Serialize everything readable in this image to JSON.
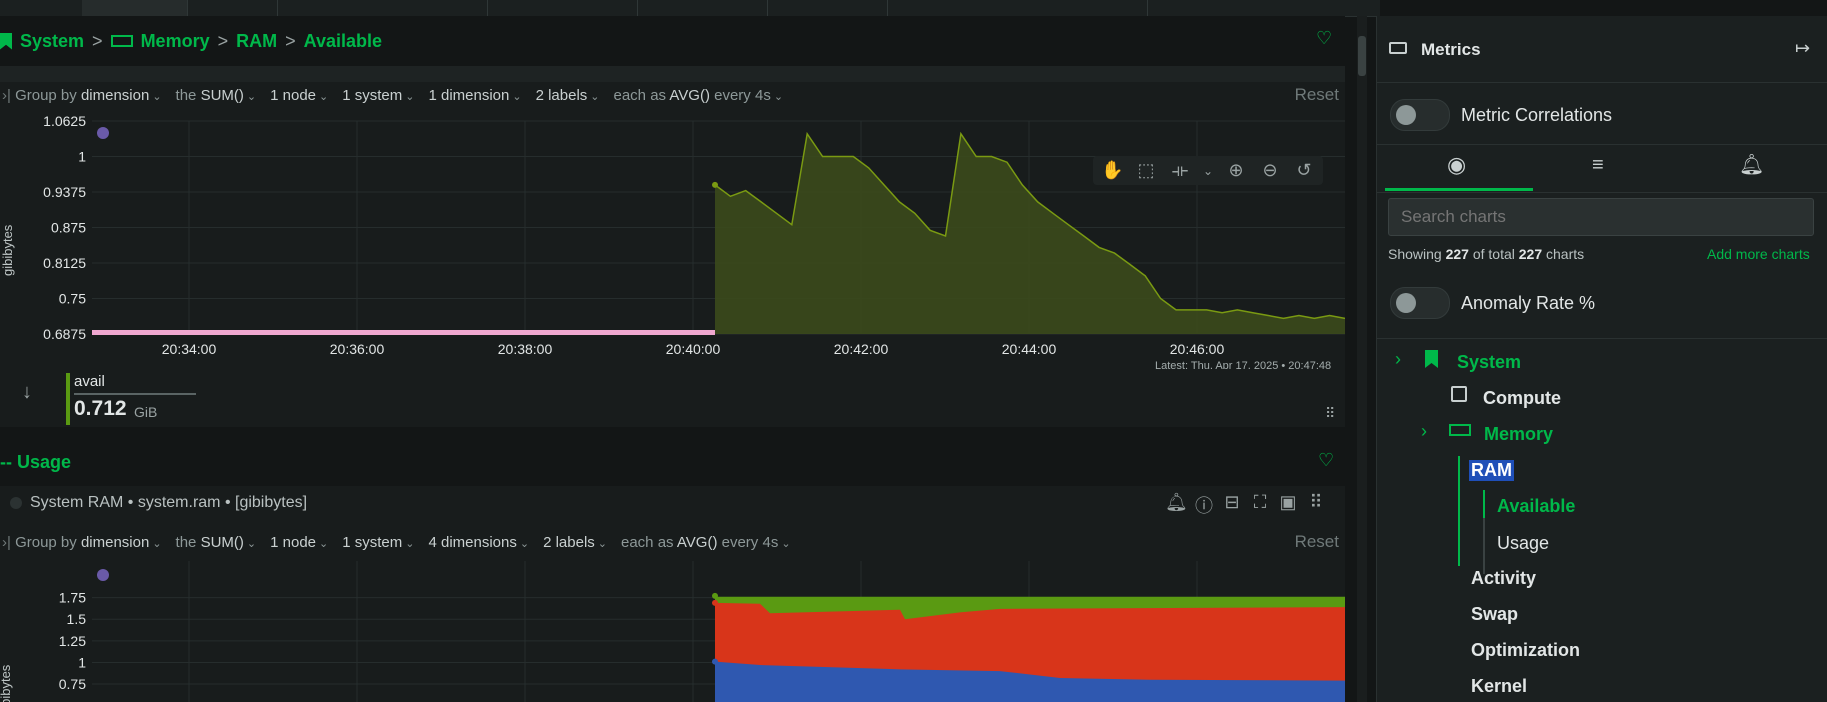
{
  "breadcrumb": {
    "system": "System",
    "memory": "Memory",
    "ram": "RAM",
    "available": "Available"
  },
  "chart1": {
    "toolbar": {
      "group_by": "Group by",
      "group_by_value": "dimension",
      "the": "the",
      "agg": "SUM()",
      "nodes": "1 node",
      "systems": "1 system",
      "dimensions": "1 dimension",
      "labels": "2 labels",
      "each_as": "each as",
      "avg": "AVG()",
      "every": "every 4s",
      "reset": "Reset"
    },
    "ylabel": "gibibytes",
    "latest": "Latest: Thu, Apr 17, 2025 • 20:47:48",
    "legend": {
      "name": "avail",
      "value": "0.712",
      "unit": "GiB"
    }
  },
  "section_usage": "-- Usage",
  "chart2": {
    "title": "System RAM • system.ram • [gibibytes]",
    "toolbar": {
      "group_by": "Group by",
      "group_by_value": "dimension",
      "the": "the",
      "agg": "SUM()",
      "nodes": "1 node",
      "systems": "1 system",
      "dimensions": "4 dimensions",
      "labels": "2 labels",
      "each_as": "each as",
      "avg": "AVG()",
      "every": "every 4s",
      "reset": "Reset"
    },
    "ylabel": "gibibytes"
  },
  "sidebar": {
    "title": "Metrics",
    "metric_correlations": "Metric Correlations",
    "search_placeholder": "Search charts",
    "showing_prefix": "Showing",
    "showing_count": "227",
    "showing_mid": "of total",
    "showing_total": "227",
    "showing_suffix": "charts",
    "add_more": "Add more charts",
    "anomaly_rate": "Anomaly Rate %",
    "tree": {
      "system": "System",
      "compute": "Compute",
      "memory": "Memory",
      "ram": "RAM",
      "available": "Available",
      "usage": "Usage",
      "activity": "Activity",
      "swap": "Swap",
      "optimization": "Optimization",
      "kernel": "Kernel"
    }
  },
  "colors": {
    "accent": "#00b84a",
    "avail_line": "#7a9a12",
    "avail_fill": "#3b4a1c",
    "pink": "#f0a8d0",
    "series_green": "#5a9a12",
    "series_red": "#d8351a",
    "series_blue": "#2f58b0"
  },
  "chart_data": [
    {
      "type": "area",
      "ylabel": "gibibytes",
      "x_ticks": [
        "20:34:00",
        "20:36:00",
        "20:38:00",
        "20:40:00",
        "20:42:00",
        "20:44:00",
        "20:46:00"
      ],
      "y_ticks": [
        "0.6875",
        "0.75",
        "0.8125",
        "0.875",
        "0.9375",
        "1",
        "1.0625"
      ],
      "ylim": [
        0.6875,
        1.0625
      ],
      "series": [
        {
          "name": "avail",
          "x": [
            0,
            1,
            2,
            3,
            4,
            5,
            6,
            7,
            8,
            9,
            10,
            11,
            12,
            13,
            14,
            15,
            16,
            17,
            18,
            19,
            20,
            21,
            22,
            23,
            24,
            25,
            26,
            27,
            28,
            29,
            30,
            31,
            32,
            33,
            34,
            35,
            36,
            37,
            38,
            39,
            40,
            41
          ],
          "values": [
            0.95,
            0.93,
            0.94,
            0.92,
            0.9,
            0.88,
            1.04,
            1.0,
            1.0,
            1.0,
            0.98,
            0.95,
            0.92,
            0.9,
            0.87,
            0.86,
            1.04,
            1.0,
            1.0,
            0.99,
            0.95,
            0.92,
            0.9,
            0.88,
            0.86,
            0.84,
            0.83,
            0.81,
            0.79,
            0.75,
            0.73,
            0.73,
            0.73,
            0.725,
            0.73,
            0.725,
            0.72,
            0.715,
            0.72,
            0.715,
            0.72,
            0.715
          ]
        }
      ]
    },
    {
      "type": "area",
      "ylabel": "gibibytes",
      "y_ticks": [
        "0.75",
        "1",
        "1.25",
        "1.5",
        "1.75"
      ],
      "ylim": [
        0.6,
        1.85
      ]
    }
  ]
}
